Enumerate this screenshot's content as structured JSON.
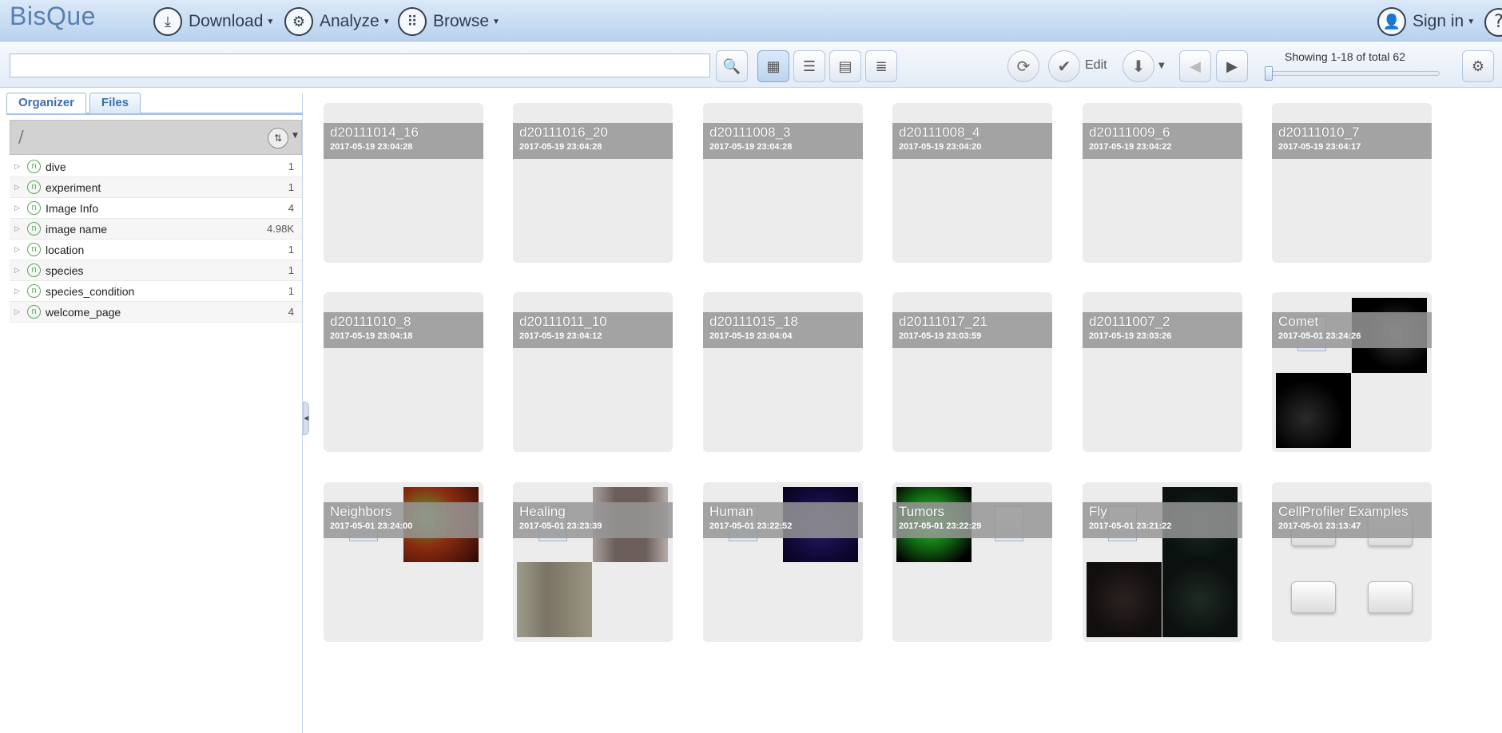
{
  "app": {
    "logo": "BisQue"
  },
  "topnav": {
    "download": "Download",
    "analyze": "Analyze",
    "browse": "Browse",
    "sign_in": "Sign in"
  },
  "toolbar": {
    "search_value": "",
    "edit_label": "Edit",
    "showing": "Showing 1-18 of total 62",
    "zoom_level": 0.0
  },
  "left_panel": {
    "tabs": [
      "Organizer",
      "Files"
    ],
    "active_tab": "Organizer",
    "path": "/",
    "tree": [
      {
        "label": "dive",
        "count": "1"
      },
      {
        "label": "experiment",
        "count": "1"
      },
      {
        "label": "Image Info",
        "count": "4"
      },
      {
        "label": "image name",
        "count": "4.98K"
      },
      {
        "label": "location",
        "count": "1"
      },
      {
        "label": "species",
        "count": "1"
      },
      {
        "label": "species_condition",
        "count": "1"
      },
      {
        "label": "welcome_page",
        "count": "4"
      }
    ]
  },
  "items": [
    {
      "name": "d20111014_16",
      "date": "2017-05-19 23:04:28"
    },
    {
      "name": "d20111016_20",
      "date": "2017-05-19 23:04:28"
    },
    {
      "name": "d20111008_3",
      "date": "2017-05-19 23:04:28"
    },
    {
      "name": "d20111008_4",
      "date": "2017-05-19 23:04:20"
    },
    {
      "name": "d20111009_6",
      "date": "2017-05-19 23:04:22"
    },
    {
      "name": "d20111010_7",
      "date": "2017-05-19 23:04:17"
    },
    {
      "name": "d20111010_8",
      "date": "2017-05-19 23:04:18"
    },
    {
      "name": "d20111011_10",
      "date": "2017-05-19 23:04:12"
    },
    {
      "name": "d20111015_18",
      "date": "2017-05-19 23:04:04"
    },
    {
      "name": "d20111017_21",
      "date": "2017-05-19 23:03:59"
    },
    {
      "name": "d20111007_2",
      "date": "2017-05-19 23:03:26"
    },
    {
      "name": "Comet",
      "date": "2017-05-01 23:24:26"
    },
    {
      "name": "Neighbors",
      "date": "2017-05-01 23:24:00"
    },
    {
      "name": "Healing",
      "date": "2017-05-01 23:23:39"
    },
    {
      "name": "Human",
      "date": "2017-05-01 23:22:52"
    },
    {
      "name": "Tumors",
      "date": "2017-05-01 23:22:29"
    },
    {
      "name": "Fly",
      "date": "2017-05-01 23:21:22"
    },
    {
      "name": "CellProfiler Examples",
      "date": "2017-05-01 23:13:47"
    }
  ],
  "colors": {
    "accent": "#3b6fb0",
    "header_bg": "#b9d2ee"
  }
}
